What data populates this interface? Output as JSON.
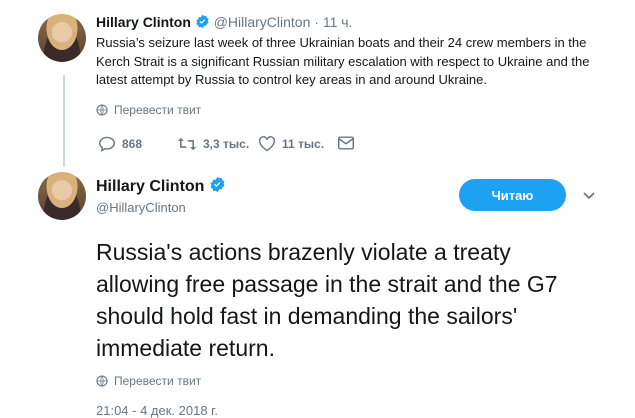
{
  "reply_tweet": {
    "display_name": "Hillary Clinton",
    "handle": "@HillaryClinton",
    "separator": "·",
    "time": "11 ч.",
    "text": "Russia’s seizure last week of three Ukrainian boats and their 24 crew members in the Kerch Strait is a significant Russian military escalation with respect to Ukraine and the latest attempt by Russia to control key areas in and around Ukraine.",
    "translate_label": "Перевести твит",
    "reply_count": "868",
    "retweet_count": "3,3 тыс.",
    "like_count": "11 тыс."
  },
  "main_tweet": {
    "display_name": "Hillary Clinton",
    "handle": "@HillaryClinton",
    "follow_label": "Читаю",
    "text": "Russia's actions brazenly violate a treaty allowing free passage in the strait and the G7 should hold fast in demanding the sailors' immediate return.",
    "translate_label": "Перевести твит",
    "timestamp": "21:04 - 4 дек. 2018 г."
  },
  "colors": {
    "accent": "#1da1f2",
    "muted": "#657786",
    "line": "#ccd6dd"
  }
}
